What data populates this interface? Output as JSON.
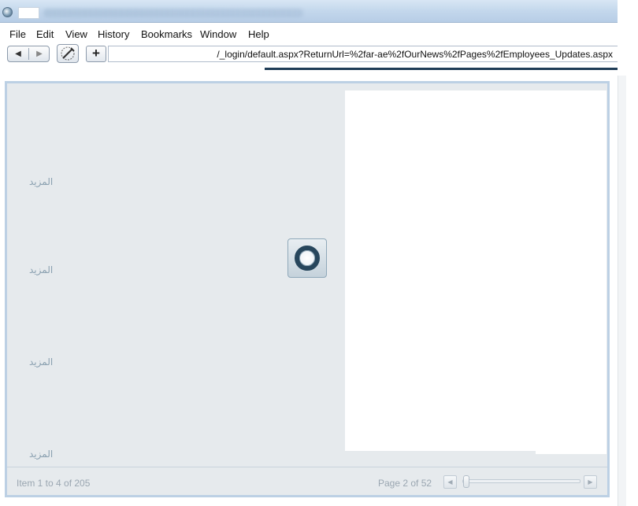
{
  "menu": {
    "items": [
      "File",
      "Edit",
      "View",
      "History",
      "Bookmarks",
      "Window",
      "Help"
    ]
  },
  "address": {
    "url": "/_login/default.aspx?ReturnUrl=%2far-ae%2fOurNews%2fPages%2fEmployees_Updates.aspx"
  },
  "toolbar": {
    "back_glyph": "◀",
    "forward_glyph": "▶",
    "new_tab_glyph": "+"
  },
  "content": {
    "more_links": [
      "المزيد",
      "المزيد",
      "المزيد",
      "المزيد"
    ]
  },
  "pager": {
    "item_range": "Item 1 to 4 of 205",
    "page_status": "Page 2 of 52",
    "prev_glyph": "◀",
    "next_glyph": "▶",
    "slider_value": 0.02
  },
  "colors": {
    "panel_bg": "#e6eaed",
    "panel_border": "#bcd0e4",
    "spinner_ring": "#27465c",
    "link_text": "#8aa0b0"
  },
  "icons": {
    "app": "browser-app-icon",
    "back": "back-arrow-icon",
    "forward": "forward-arrow-icon",
    "settings": "settings-brush-icon",
    "loading": "loading-ring-icon"
  }
}
